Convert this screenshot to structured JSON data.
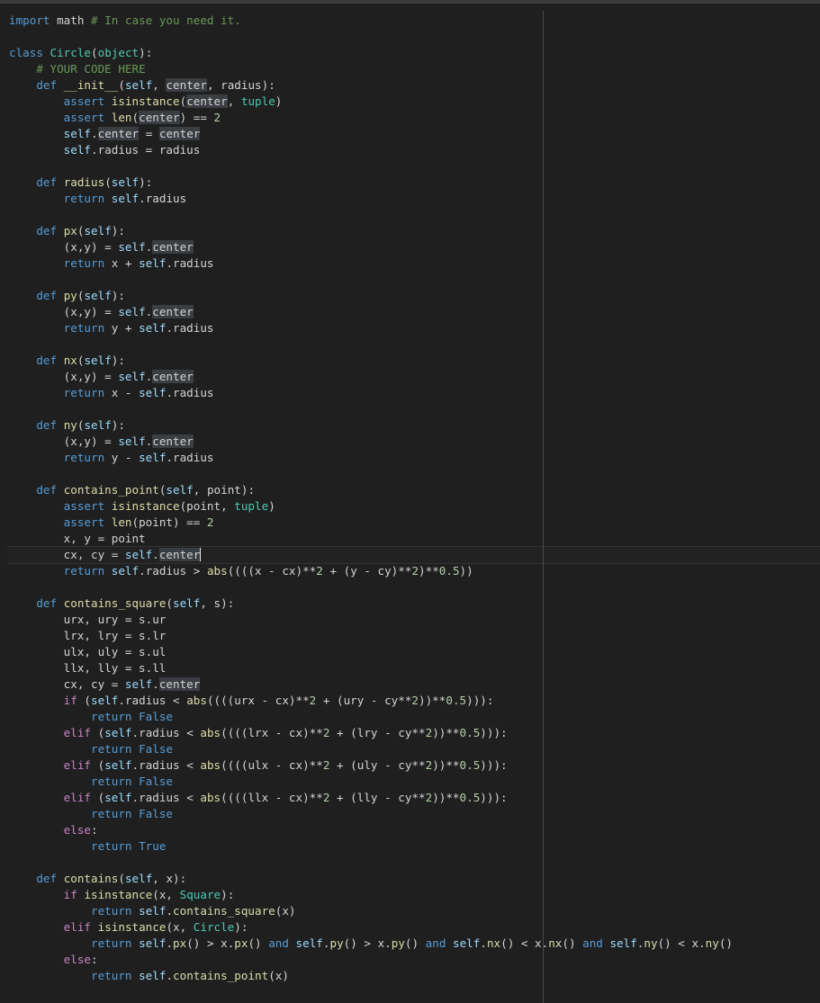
{
  "colors": {
    "background": "#1f1f1f",
    "keyword": "#569cd6",
    "control": "#c586c0",
    "function": "#dcdcaa",
    "class": "#4ec9b0",
    "number": "#b5cea8",
    "comment": "#6a9955",
    "text": "#d4d4d4"
  },
  "code": {
    "lines": [
      "import math # In case you need it.",
      "",
      "class Circle(object):",
      "    # YOUR CODE HERE",
      "    def __init__(self, center, radius):",
      "        assert isinstance(center, tuple)",
      "        assert len(center) == 2",
      "        self.center = center",
      "        self.radius = radius",
      "",
      "    def radius(self):",
      "        return self.radius",
      "",
      "    def px(self):",
      "        (x,y) = self.center",
      "        return x + self.radius",
      "",
      "    def py(self):",
      "        (x,y) = self.center",
      "        return y + self.radius",
      "",
      "    def nx(self):",
      "        (x,y) = self.center",
      "        return x - self.radius",
      "",
      "    def ny(self):",
      "        (x,y) = self.center",
      "        return y - self.radius",
      "",
      "    def contains_point(self, point):",
      "        assert isinstance(point, tuple)",
      "        assert len(point) == 2",
      "        x, y = point",
      "        cx, cy = self.center",
      "        return self.radius > abs((((x - cx)**2 + (y - cy)**2)**0.5))",
      "",
      "    def contains_square(self, s):",
      "        urx, ury = s.ur",
      "        lrx, lry = s.lr",
      "        ulx, uly = s.ul",
      "        llx, lly = s.ll",
      "        cx, cy = self.center",
      "        if (self.radius < abs((((urx - cx)**2 + (ury - cy**2))**0.5))):",
      "            return False",
      "        elif (self.radius < abs((((lrx - cx)**2 + (lry - cy**2))**0.5))):",
      "            return False",
      "        elif (self.radius < abs((((ulx - cx)**2 + (uly - cy**2))**0.5))):",
      "            return False",
      "        elif (self.radius < abs((((llx - cx)**2 + (lly - cy**2))**0.5))):",
      "            return False",
      "        else:",
      "            return True",
      "",
      "    def contains(self, x):",
      "        if isinstance(x, Square):",
      "            return self.contains_square(x)",
      "        elif isinstance(x, Circle):",
      "            return self.px() > x.px() and self.py() > x.py() and self.nx() < x.nx() and self.ny() < x.ny()",
      "        else:",
      "            return self.contains_point(x)"
    ]
  }
}
